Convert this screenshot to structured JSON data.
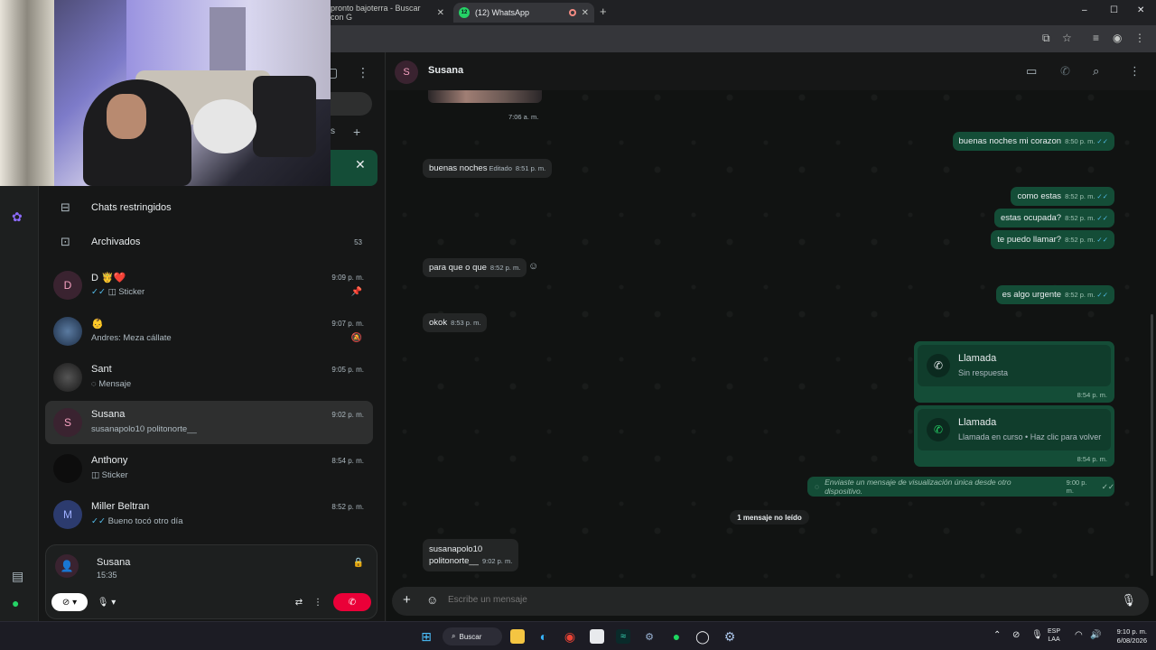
{
  "browser": {
    "tabs": [
      {
        "label": "pronto bajoterra - Buscar con G"
      },
      {
        "label": "(12) WhatsApp",
        "badge": "12"
      }
    ],
    "new_tab": "+",
    "window_controls": {
      "minimize": "–",
      "maximize": "☐",
      "close": "✕"
    }
  },
  "sidebar": {
    "special_rows": [
      {
        "label": "Chats restringidos",
        "icon": "lock-chat-icon"
      },
      {
        "label": "Archivados",
        "icon": "archive-icon",
        "count": "53"
      }
    ],
    "chats": [
      {
        "avatar": "D",
        "name": "D 🤴❤️",
        "time": "9:09 p. m.",
        "preview": "Sticker",
        "tick": "✓✓",
        "meta_icon": "pin-icon"
      },
      {
        "avatar": "",
        "name": "👶",
        "time": "9:07 p. m.",
        "preview": "Andres: Meza cállate",
        "meta_icon": "muted-icon"
      },
      {
        "avatar": "",
        "name": "Sant",
        "time": "9:05 p. m.",
        "preview": "Mensaje"
      },
      {
        "avatar": "S",
        "name": "Susana",
        "time": "9:02 p. m.",
        "preview": "susanapolo10 politonorte__"
      },
      {
        "avatar": "",
        "name": "Anthony",
        "time": "8:54 p. m.",
        "preview": "Sticker"
      },
      {
        "avatar": "M",
        "name": "Miller Beltran",
        "time": "8:52 p. m.",
        "preview": "Bueno tocó otro día",
        "tick": "✓✓"
      }
    ],
    "call": {
      "avatar": "S",
      "name": "Susana",
      "duration": "15:35"
    }
  },
  "chat": {
    "contact": {
      "avatar": "S",
      "name": "Susana"
    },
    "messages": {
      "m0_time": "7:06 a. m.",
      "m1": {
        "text": "buenas noches mi corazon",
        "time": "8:50 p. m.",
        "tick": "✓✓"
      },
      "m2": {
        "text": "buenas noches",
        "edited": "Editado",
        "time": "8:51 p. m."
      },
      "m3": {
        "text": "como estas",
        "time": "8:52 p. m.",
        "tick": "✓✓"
      },
      "m4": {
        "text": "estas ocupada?",
        "time": "8:52 p. m.",
        "tick": "✓✓"
      },
      "m5": {
        "text": "te puedo llamar?",
        "time": "8:52 p. m.",
        "tick": "✓✓"
      },
      "m6": {
        "text": "para que o que",
        "time": "8:52 p. m."
      },
      "m7": {
        "text": "es algo urgente",
        "time": "8:52 p. m.",
        "tick": "✓✓"
      },
      "m8": {
        "text": "okok",
        "time": "8:53 p. m."
      },
      "call1": {
        "title": "Llamada",
        "subtitle": "Sin respuesta",
        "time": "8:54 p. m."
      },
      "call2": {
        "title": "Llamada",
        "subtitle": "Llamada en curso • Haz clic para volver",
        "time": "8:54 p. m."
      },
      "viewonce": {
        "text": "Enviaste un mensaje de visualización única desde otro dispositivo.",
        "time": "9:00 p. m.",
        "tick": "✓✓"
      },
      "unread_divider": "1 mensaje no leído",
      "m9": {
        "line1": "susanapolo10",
        "line2": "politonorte__",
        "time": "9:02 p. m."
      }
    },
    "composer": {
      "placeholder": "Escribe un mensaje"
    }
  },
  "taskbar": {
    "search_label": "Buscar",
    "lang": {
      "line1": "ESP",
      "line2": "LAA"
    },
    "clock": {
      "time": "9:10 p. m.",
      "date": "6/08/2026"
    }
  }
}
